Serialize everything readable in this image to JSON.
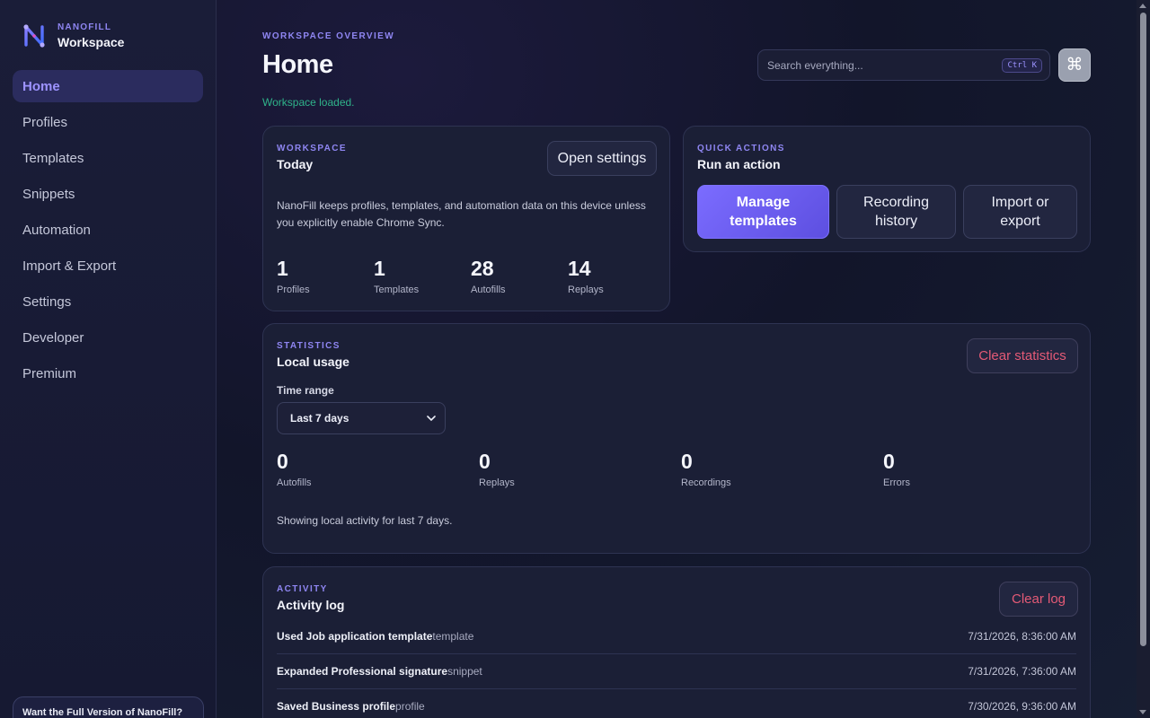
{
  "brand": {
    "sub": "NANOFILL",
    "name": "Workspace"
  },
  "nav": {
    "items": [
      {
        "label": "Home"
      },
      {
        "label": "Profiles"
      },
      {
        "label": "Templates"
      },
      {
        "label": "Snippets"
      },
      {
        "label": "Automation"
      },
      {
        "label": "Import & Export"
      },
      {
        "label": "Settings"
      },
      {
        "label": "Developer"
      },
      {
        "label": "Premium"
      }
    ]
  },
  "promo": {
    "text": "Want the Full Version of NanoFill?"
  },
  "header": {
    "eyebrow": "WORKSPACE OVERVIEW",
    "title": "Home",
    "status": "Workspace loaded.",
    "search_placeholder": "Search everything...",
    "shortcut": "Ctrl K",
    "command_glyph": "⌘"
  },
  "workspace": {
    "eyebrow": "WORKSPACE",
    "title": "Today",
    "settings_button": "Open settings",
    "description": "NanoFill keeps profiles, templates, and automation data on this device unless you explicitly enable Chrome Sync.",
    "stats": [
      {
        "value": "1",
        "label": "Profiles"
      },
      {
        "value": "1",
        "label": "Templates"
      },
      {
        "value": "28",
        "label": "Autofills"
      },
      {
        "value": "14",
        "label": "Replays"
      }
    ]
  },
  "quick_actions": {
    "eyebrow": "QUICK ACTIONS",
    "title": "Run an action",
    "buttons": [
      {
        "label": "Manage templates"
      },
      {
        "label": "Recording history"
      },
      {
        "label": "Import or export"
      }
    ]
  },
  "statistics": {
    "eyebrow": "STATISTICS",
    "title": "Local usage",
    "clear_button": "Clear statistics",
    "range_label": "Time range",
    "range_value": "Last 7 days",
    "stats": [
      {
        "value": "0",
        "label": "Autofills"
      },
      {
        "value": "0",
        "label": "Replays"
      },
      {
        "value": "0",
        "label": "Recordings"
      },
      {
        "value": "0",
        "label": "Errors"
      }
    ],
    "note": "Showing local activity for last 7 days."
  },
  "activity": {
    "eyebrow": "ACTIVITY",
    "title": "Activity log",
    "clear_button": "Clear log",
    "rows": [
      {
        "title": "Used Job application template",
        "kind": "template",
        "time": "7/31/2026, 8:36:00 AM"
      },
      {
        "title": "Expanded Professional signature",
        "kind": "snippet",
        "time": "7/31/2026, 7:36:00 AM"
      },
      {
        "title": "Saved Business profile",
        "kind": "profile",
        "time": "7/30/2026, 9:36:00 AM"
      }
    ]
  },
  "colors": {
    "accent": "#8f86f2",
    "success": "#2fb38a",
    "danger": "#e45a76",
    "primary": "#6c5ef2"
  }
}
